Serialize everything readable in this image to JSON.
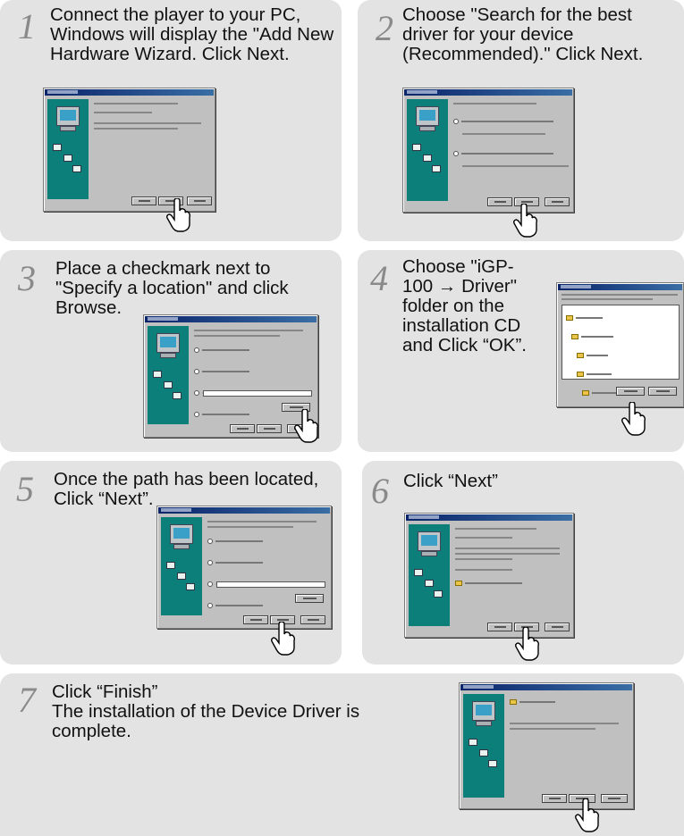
{
  "steps": [
    {
      "number": "1",
      "lines": [
        "Connect the player to your PC,",
        "Windows will display the \"Add New",
        "Hardware Wizard. Click Next."
      ]
    },
    {
      "number": "2",
      "lines": [
        "Choose \"Search for the best",
        "driver for your device",
        "(Recommended).\" Click Next."
      ]
    },
    {
      "number": "3",
      "lines": [
        "Place a checkmark next to",
        "\"Specify a location\" and click",
        "Browse."
      ]
    },
    {
      "number": "4",
      "lines": [
        "Choose \"iGP-",
        "100 → Driver\"",
        "folder on the",
        "installation CD",
        "and Click “OK”."
      ]
    },
    {
      "number": "5",
      "lines": [
        "Once the path has been located,",
        "Click “Next”."
      ]
    },
    {
      "number": "6",
      "lines": [
        "Click “Next”"
      ]
    },
    {
      "number": "7",
      "lines": [
        "Click “Finish”",
        "The installation of the Device Driver is",
        "complete."
      ]
    }
  ],
  "icons": {
    "cursor": "hand-pointer-icon",
    "wizard_image": "computer-icon"
  },
  "colors": {
    "card_bg": "#e3e3e3",
    "step_number": "#8a8a8a",
    "wizard_panel": "#0d7f7a",
    "title_bar": "#0a246a"
  }
}
